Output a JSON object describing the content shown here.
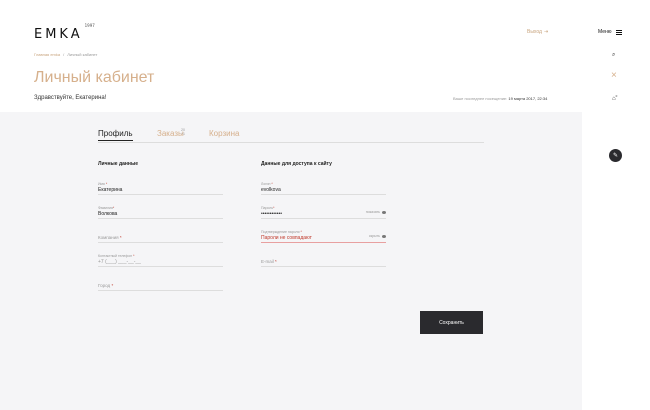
{
  "header": {
    "logo": "EMKA",
    "logo_sup": "1997",
    "login_label": "Выход",
    "menu_label": "Меню"
  },
  "breadcrumb": {
    "home": "Главная emka",
    "separator": "/",
    "current": "Личный кабинет"
  },
  "page": {
    "title": "Личный кабинет",
    "greeting": "Здравствуйте, Екатерина!",
    "last_visit_label": "Ваше последнее посещение:",
    "last_visit_value": "19 марта 2017, 22:34"
  },
  "tabs": [
    {
      "label": "Профиль",
      "active": true
    },
    {
      "label": "Заказы",
      "badge": "20 +1"
    },
    {
      "label": "Корзина"
    }
  ],
  "personal": {
    "title": "Личные данные",
    "fields": [
      {
        "label": "Имя",
        "value": "Екатерина"
      },
      {
        "label": "Фамилия",
        "value": "Волкова"
      },
      {
        "label": "Компания",
        "value": ""
      },
      {
        "label": "Контактный телефон",
        "value": "+7 (___) ___-__-__"
      },
      {
        "label": "Город",
        "value": ""
      }
    ]
  },
  "access": {
    "title": "Данные для доступа к сайту",
    "fields": [
      {
        "label": "Логин",
        "value": "evolkova"
      },
      {
        "label": "Пароль",
        "value": "••••••••••••",
        "side": "показать"
      },
      {
        "label": "Подтверждение пароля",
        "error": "Пароли не совпадают",
        "side": "скрыть"
      },
      {
        "label": "E-mail",
        "value": ""
      }
    ]
  },
  "save_label": "Сохранить",
  "colors": {
    "accent": "#d6b08c",
    "dark": "#2a2a2e",
    "error": "#c0392b",
    "panel": "#f5f5f7"
  },
  "icons": {
    "login": "exit-icon",
    "menu": "hamburger-icon",
    "search": "search-icon",
    "close": "close-icon",
    "cart": "cart-icon",
    "edit": "pencil-icon"
  },
  "cart_badge": "0"
}
